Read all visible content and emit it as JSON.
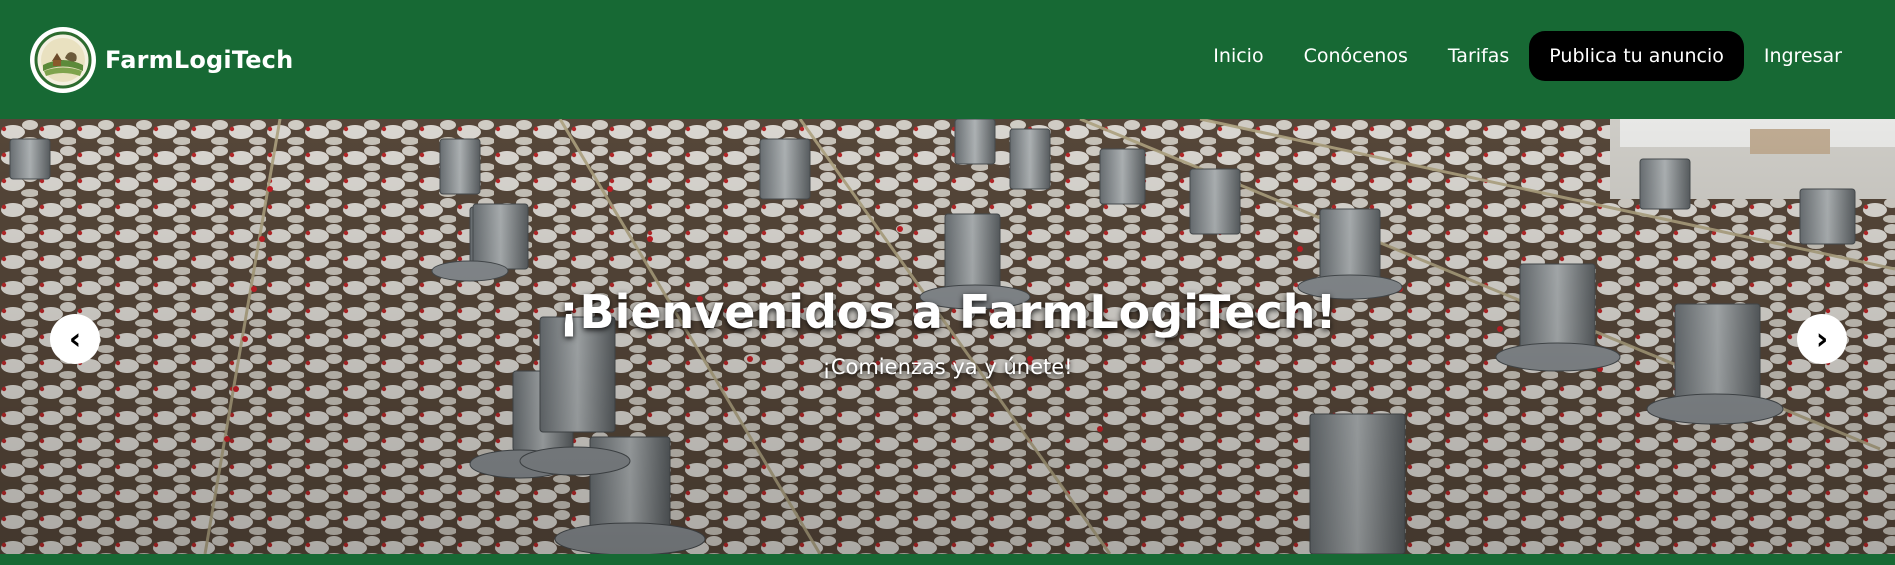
{
  "brand": {
    "name": "FarmLogiTech",
    "logo_icon": "farm-barn-logo-icon"
  },
  "nav": {
    "items": [
      {
        "label": "Inicio"
      },
      {
        "label": "Conócenos"
      },
      {
        "label": "Tarifas"
      },
      {
        "label": "Publica tu anuncio"
      },
      {
        "label": "Ingresar"
      }
    ]
  },
  "hero": {
    "title": "¡Bienvenidos a FarmLogiTech!",
    "subtitle": "¡Comienzas ya y únete!",
    "prev_icon": "‹",
    "next_icon": "›",
    "image": "poultry-farm-photo"
  },
  "colors": {
    "header_bg": "#176934",
    "cta_bg": "#000000",
    "text": "#ffffff"
  }
}
